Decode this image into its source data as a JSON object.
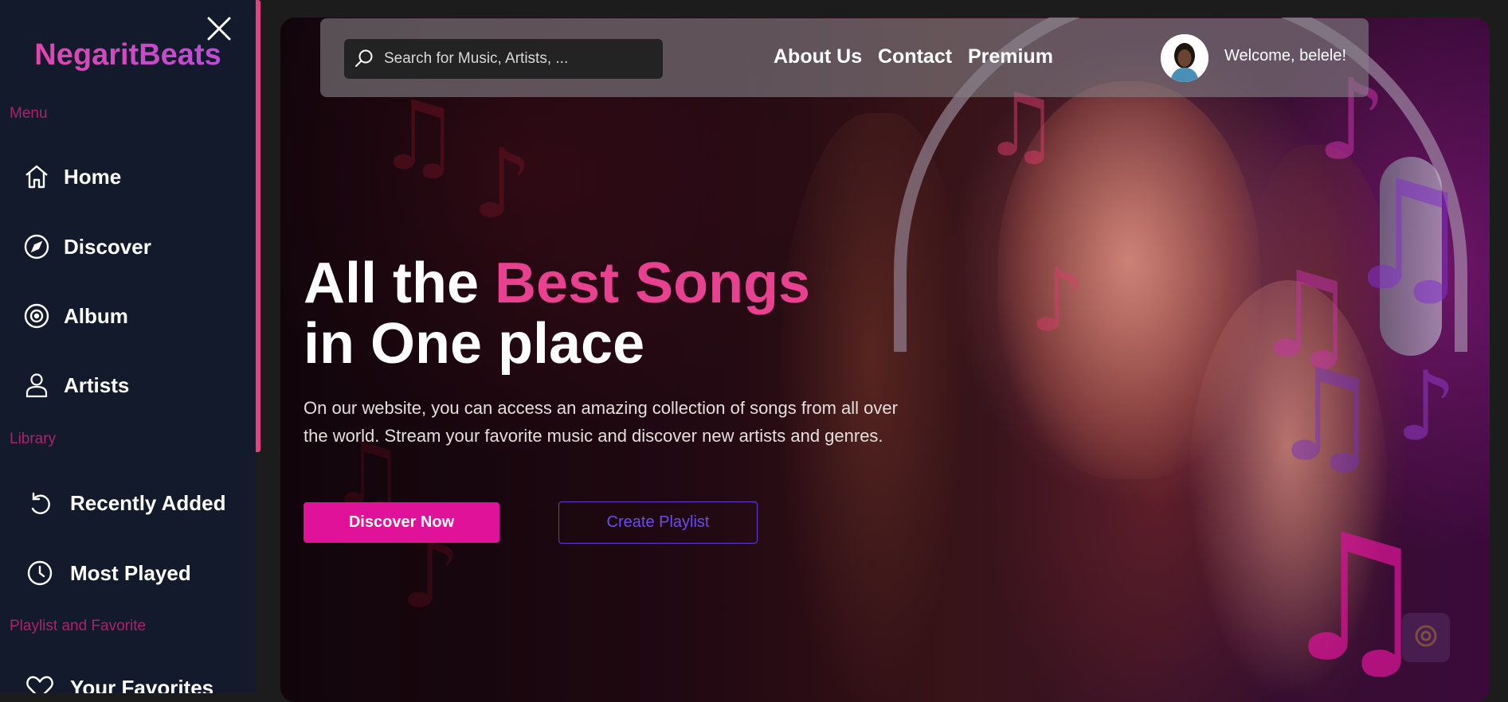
{
  "sidebar": {
    "brand": "NegaritBeats",
    "sections": {
      "menu": "Menu",
      "library": "Library",
      "playlist": "Playlist and Favorite"
    },
    "items": [
      {
        "label": "Home",
        "icon": "home-icon"
      },
      {
        "label": "Discover",
        "icon": "compass-icon"
      },
      {
        "label": "Album",
        "icon": "disc-icon"
      },
      {
        "label": "Artists",
        "icon": "user-icon"
      },
      {
        "label": "Recently Added",
        "icon": "history-icon"
      },
      {
        "label": "Most Played",
        "icon": "clock-icon"
      },
      {
        "label": "Your Favorites",
        "icon": "heart-icon"
      }
    ]
  },
  "topbar": {
    "search_placeholder": "Search for Music, Artists, ...",
    "links": [
      "About Us",
      "Contact",
      "Premium"
    ],
    "welcome": "Welcome, belele!"
  },
  "hero": {
    "title_part1": "All the ",
    "title_accent": "Best Songs",
    "title_line2": "in One place",
    "description": "On our website, you can access an amazing collection of songs from all over the world. Stream your favorite music and discover new artists and genres.",
    "primary_button": "Discover Now",
    "secondary_button": "Create Playlist"
  },
  "colors": {
    "accent_pink": "#e8418f",
    "button_pink": "#e0129a",
    "outline_purple": "#5b3fd4",
    "sidebar_bg": "#121a2c",
    "section_label": "#a8246f"
  }
}
